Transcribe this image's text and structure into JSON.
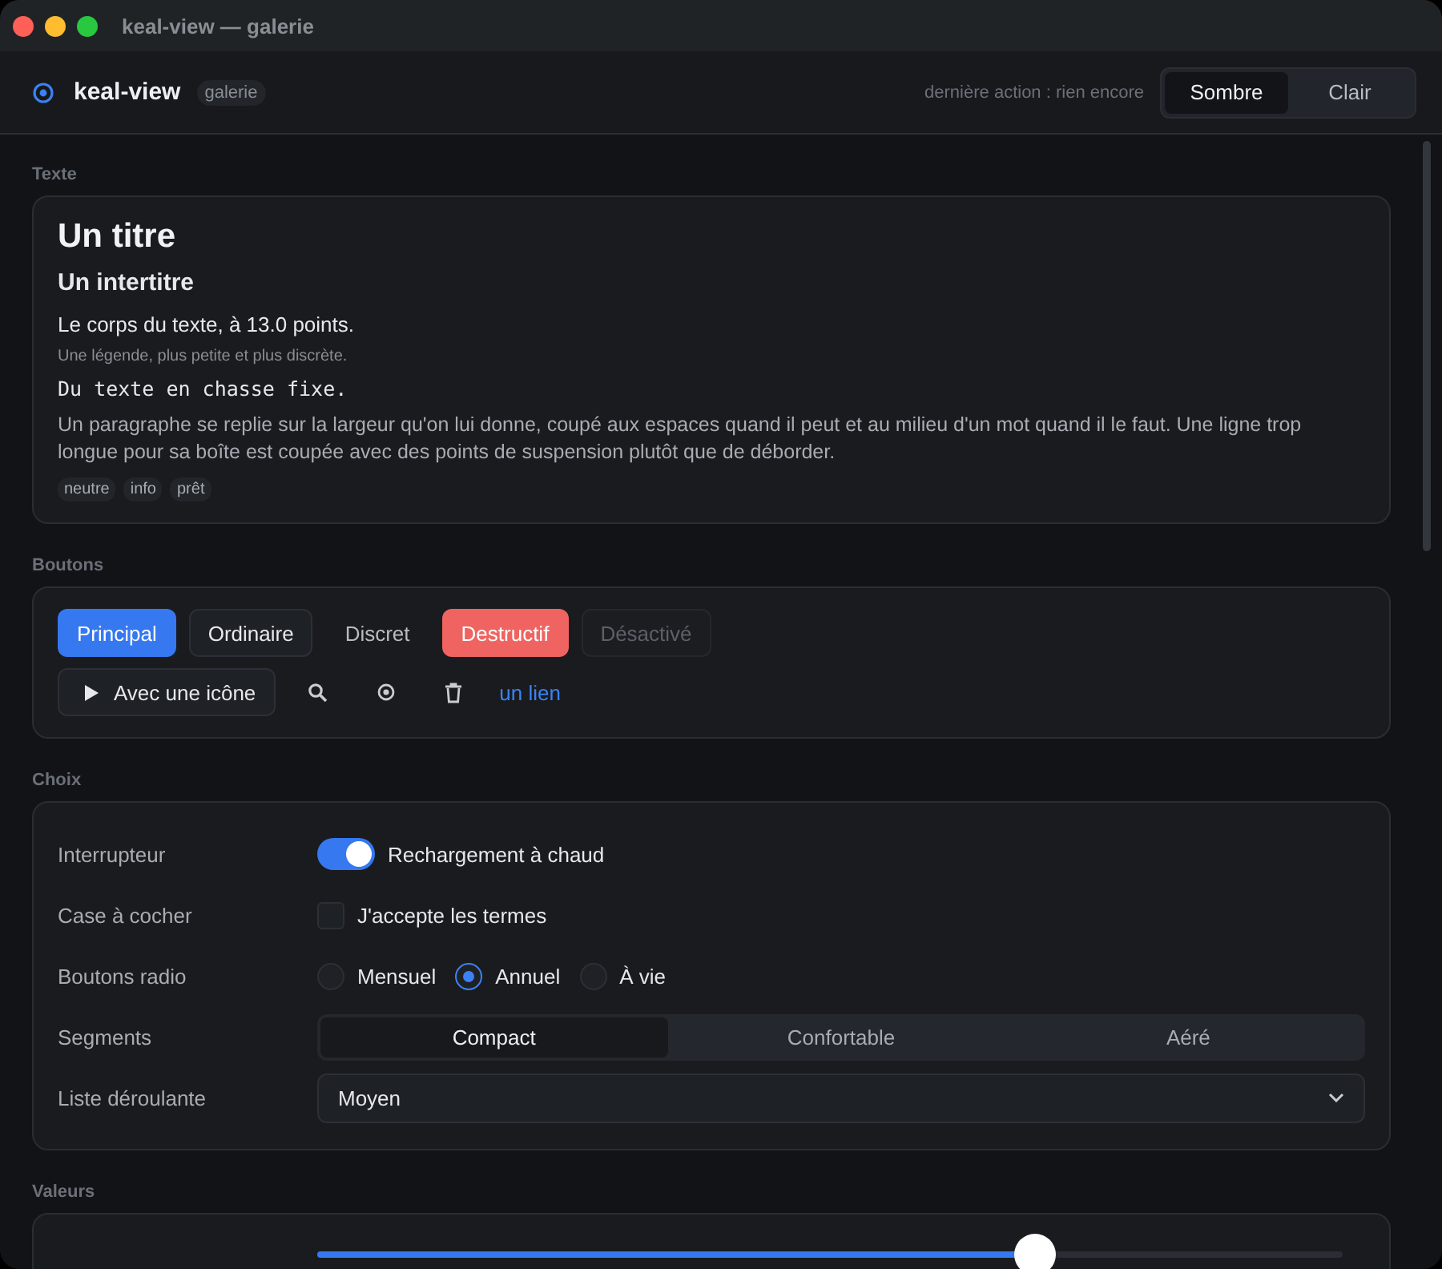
{
  "window": {
    "title": "keal-view — galerie"
  },
  "header": {
    "app_name": "keal-view",
    "badge": "galerie",
    "status": "dernière action : rien encore",
    "theme_options": [
      {
        "label": "Sombre",
        "selected": true
      },
      {
        "label": "Clair",
        "selected": false
      }
    ]
  },
  "sections": [
    {
      "kind": "text",
      "title": "Texte",
      "heading": "Un titre",
      "subheading": "Un intertitre",
      "body": "Le corps du texte, à 13.0 points.",
      "caption": "Une légende, plus petite et plus discrète.",
      "mono": "Du texte en chasse fixe.",
      "paragraph": "Un paragraphe se replie sur la largeur qu'on lui donne, coupé aux espaces quand il peut et au milieu d'un mot quand il le faut. Une ligne trop longue pour sa boîte est coupée avec des points de suspension plutôt que de déborder.",
      "tags": [
        "neutre",
        "info",
        "prêt"
      ]
    },
    {
      "kind": "buttons",
      "title": "Boutons",
      "buttons": [
        {
          "label": "Principal",
          "kind": "primary"
        },
        {
          "label": "Ordinaire",
          "kind": "normal"
        },
        {
          "label": "Discret",
          "kind": "subtle"
        },
        {
          "label": "Destructif",
          "kind": "danger"
        },
        {
          "label": "Désactivé",
          "kind": "disabled"
        }
      ],
      "icon_button": {
        "label": "Avec une icône"
      },
      "link": "un lien"
    },
    {
      "kind": "choices",
      "title": "Choix",
      "rows": [
        {
          "kind": "toggle",
          "label": "Interrupteur",
          "on": true,
          "text": "Rechargement à chaud"
        },
        {
          "kind": "checkbox",
          "label": "Case à cocher",
          "checked": false,
          "text": "J'accepte les termes"
        },
        {
          "kind": "radio",
          "label": "Boutons radio",
          "options": [
            {
              "label": "Mensuel",
              "selected": false
            },
            {
              "label": "Annuel",
              "selected": true
            },
            {
              "label": "À vie",
              "selected": false
            }
          ]
        },
        {
          "kind": "segments",
          "label": "Segments",
          "options": [
            {
              "label": "Compact",
              "selected": true
            },
            {
              "label": "Confortable",
              "selected": false
            },
            {
              "label": "Aéré",
              "selected": false
            }
          ]
        },
        {
          "kind": "select",
          "label": "Liste déroulante",
          "value": "Moyen"
        }
      ]
    },
    {
      "kind": "values",
      "title": "Valeurs",
      "slider": {
        "level": 0.7
      }
    }
  ]
}
